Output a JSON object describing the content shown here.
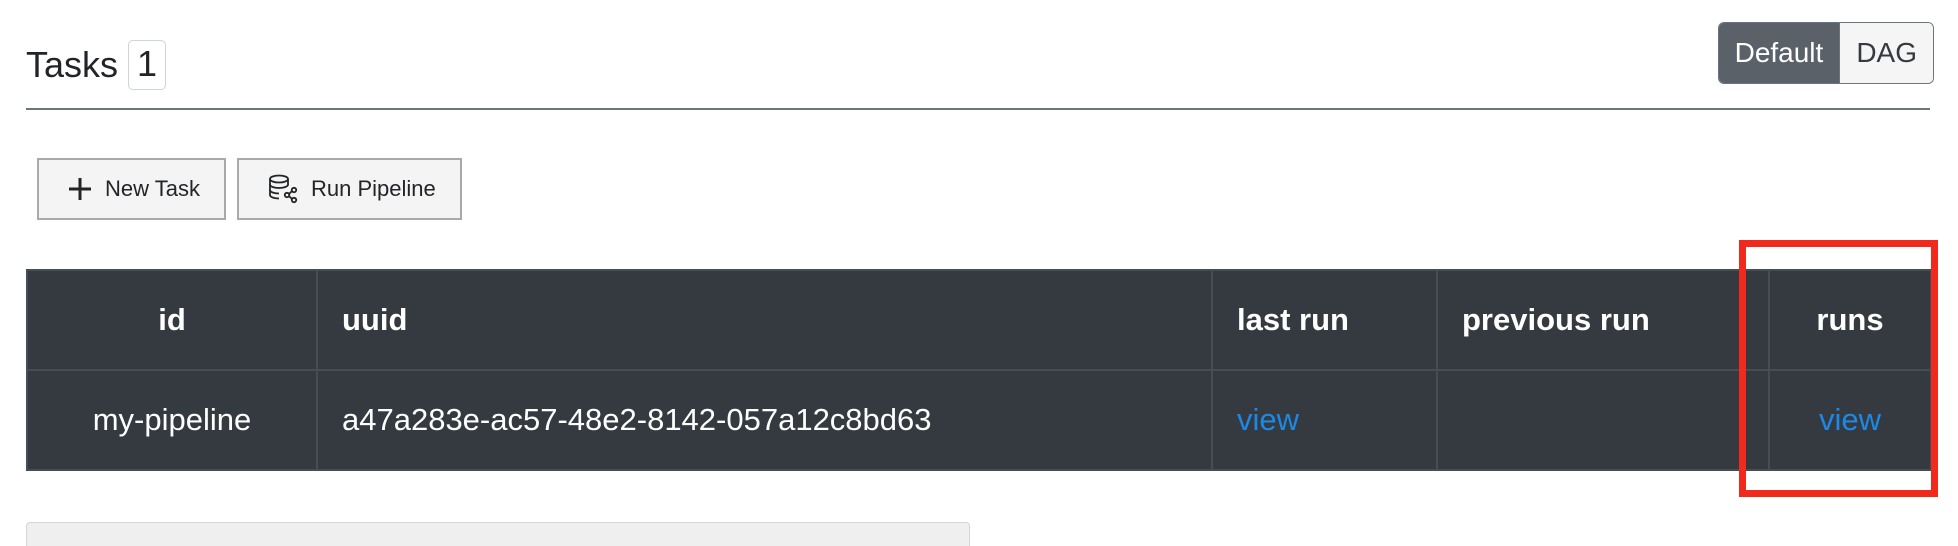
{
  "header": {
    "title": "Tasks",
    "count": "1",
    "view_toggle": {
      "default_label": "Default",
      "dag_label": "DAG",
      "selected": "Default"
    }
  },
  "actions": {
    "new_task_label": "New Task",
    "run_pipeline_label": "Run Pipeline"
  },
  "table": {
    "columns": [
      "id",
      "uuid",
      "last run",
      "previous run",
      "runs"
    ],
    "rows": [
      {
        "id": "my-pipeline",
        "uuid": "a47a283e-ac57-48e2-8142-057a12c8bd63",
        "last_run": "view",
        "previous_run": "",
        "runs": "view"
      }
    ]
  },
  "colors": {
    "table_bg": "#343a40",
    "link": "#1e88e5",
    "highlight": "#f02b1e",
    "toggle_active": "#5a6169"
  },
  "icons": {
    "new_task": "plus-icon",
    "run_pipeline": "database-pipeline-icon"
  }
}
